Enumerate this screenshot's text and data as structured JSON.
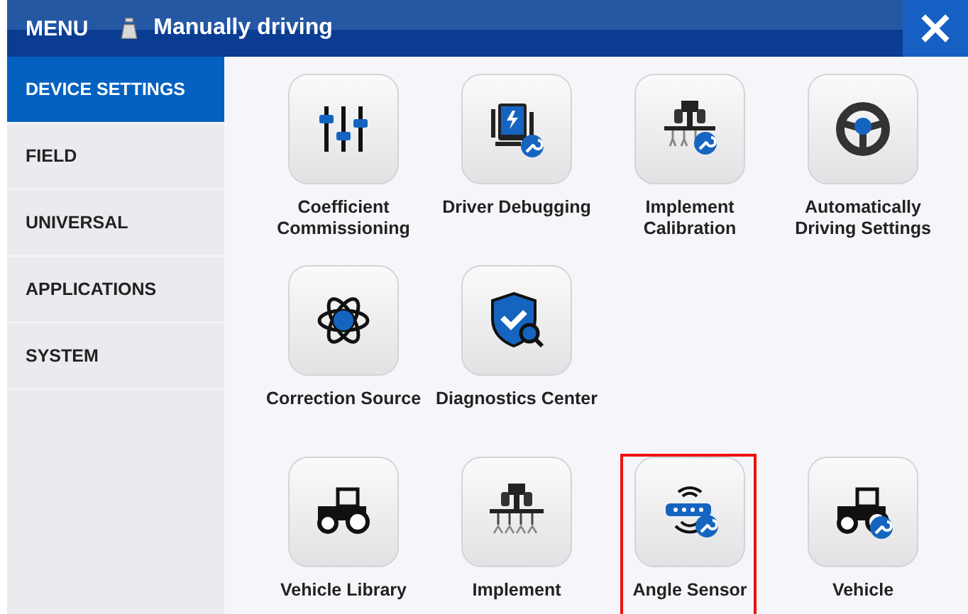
{
  "header": {
    "menu_label": "MENU",
    "mode": "Manually driving"
  },
  "sidebar": {
    "items": [
      {
        "label": "DEVICE SETTINGS",
        "selected": true
      },
      {
        "label": "FIELD",
        "selected": false
      },
      {
        "label": "UNIVERSAL",
        "selected": false
      },
      {
        "label": "APPLICATIONS",
        "selected": false
      },
      {
        "label": "SYSTEM",
        "selected": false
      }
    ]
  },
  "grid": {
    "rows": [
      {
        "tiles": [
          {
            "label": "Coefficient Commissioning",
            "highlighted": false
          },
          {
            "label": "Driver Debugging",
            "highlighted": false
          },
          {
            "label": "Implement Calibration",
            "highlighted": false
          },
          {
            "label": "Automatically Driving Settings",
            "highlighted": false
          }
        ]
      },
      {
        "tiles": [
          {
            "label": "Correction Source",
            "highlighted": false
          },
          {
            "label": "Diagnostics Center",
            "highlighted": false
          }
        ]
      },
      {
        "tiles": [
          {
            "label": "Vehicle Library",
            "highlighted": false
          },
          {
            "label": "Implement",
            "highlighted": false
          },
          {
            "label": "Angle Sensor",
            "highlighted": true
          },
          {
            "label": "Vehicle",
            "highlighted": false
          }
        ]
      }
    ]
  }
}
